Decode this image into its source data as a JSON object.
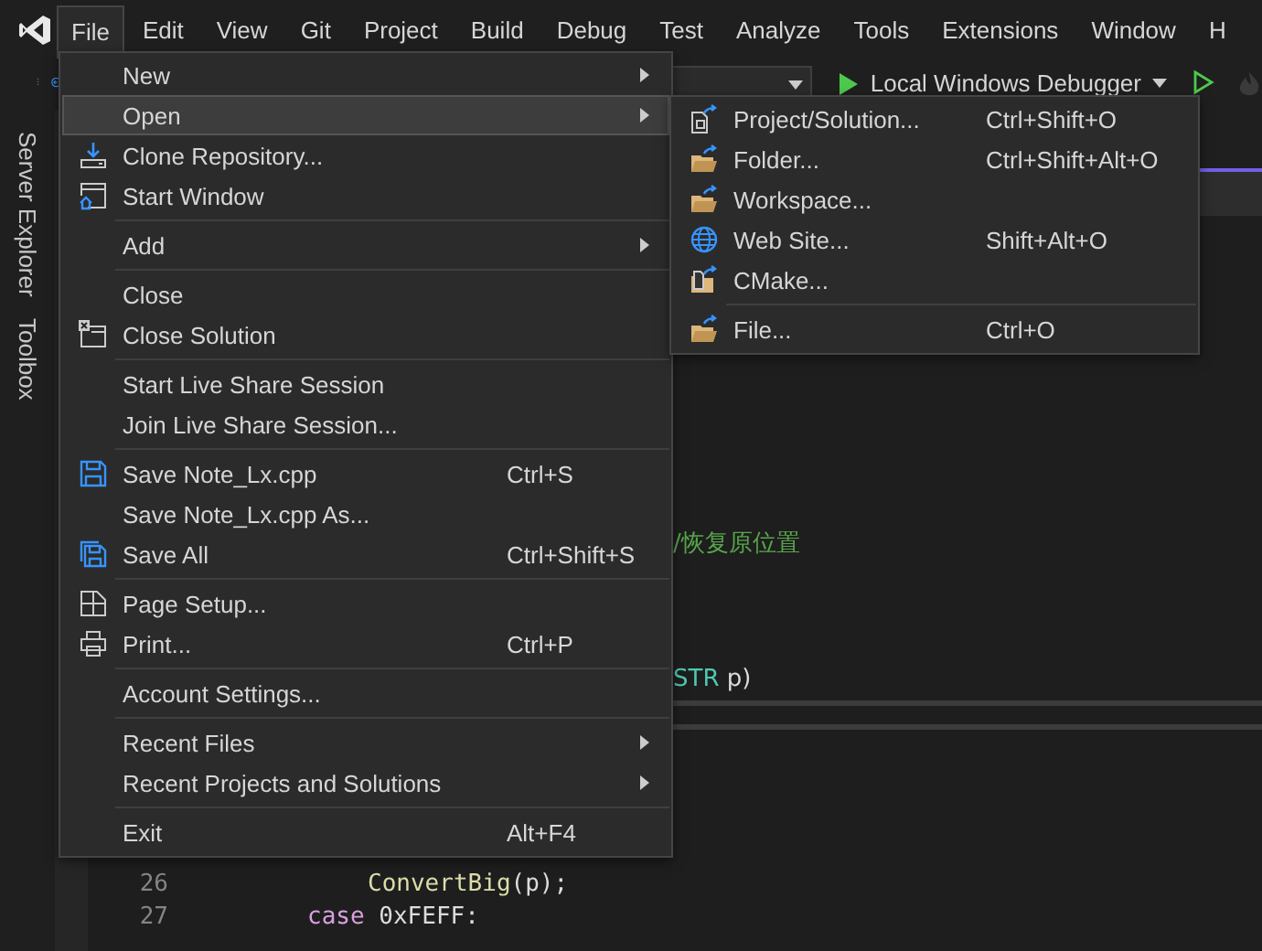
{
  "menu_bar": {
    "items": [
      {
        "label": "File",
        "selected": true
      },
      {
        "label": "Edit",
        "selected": false
      },
      {
        "label": "View",
        "selected": false
      },
      {
        "label": "Git",
        "selected": false
      },
      {
        "label": "Project",
        "selected": false
      },
      {
        "label": "Build",
        "selected": false
      },
      {
        "label": "Debug",
        "selected": false
      },
      {
        "label": "Test",
        "selected": false
      },
      {
        "label": "Analyze",
        "selected": false
      },
      {
        "label": "Tools",
        "selected": false
      },
      {
        "label": "Extensions",
        "selected": false
      },
      {
        "label": "Window",
        "selected": false
      },
      {
        "label": "H",
        "selected": false
      }
    ]
  },
  "toolbar": {
    "debugger": {
      "label": "Local Windows Debugger"
    }
  },
  "side_tabs": [
    {
      "label": "Server Explorer"
    },
    {
      "label": "Toolbox"
    }
  ],
  "editor": {
    "upper_lines": [
      {
        "segments": [
          {
            "kind": "comment",
            "text": "/恢复原位置"
          }
        ]
      },
      {
        "segments": [
          {
            "kind": "type",
            "text": "STR"
          },
          {
            "kind": "plain",
            "text": " p)"
          }
        ]
      }
    ],
    "lower_lines": [
      {
        "number": "26",
        "kind": "statement",
        "segments": [
          {
            "kind": "function",
            "text": "ConvertBig"
          },
          {
            "kind": "plain",
            "text": "(p);"
          }
        ]
      },
      {
        "number": "27",
        "kind": "label",
        "segments": [
          {
            "kind": "keyword",
            "text": "case"
          },
          {
            "kind": "plain",
            "text": " 0xFEFF:"
          }
        ]
      }
    ]
  },
  "file_menu": {
    "sections": [
      [
        {
          "label": "New",
          "has_submenu": true,
          "selected": false
        },
        {
          "label": "Open",
          "has_submenu": true,
          "selected": true
        },
        {
          "label": "Clone Repository...",
          "kind": "clone",
          "has_submenu": false,
          "selected": false
        },
        {
          "label": "Start Window",
          "kind": "start-window",
          "has_submenu": false,
          "selected": false
        }
      ],
      [
        {
          "label": "Add",
          "has_submenu": true,
          "selected": false
        }
      ],
      [
        {
          "label": "Close",
          "has_submenu": false,
          "selected": false
        },
        {
          "label": "Close Solution",
          "kind": "close-solution",
          "has_submenu": false,
          "selected": false
        }
      ],
      [
        {
          "label": "Start Live Share Session",
          "has_submenu": false,
          "selected": false
        },
        {
          "label": "Join Live Share Session...",
          "has_submenu": false,
          "selected": false
        }
      ],
      [
        {
          "label": "Save Note_Lx.cpp",
          "shortcut": "Ctrl+S",
          "kind": "save",
          "has_submenu": false,
          "selected": false
        },
        {
          "label": "Save Note_Lx.cpp As...",
          "has_submenu": false,
          "selected": false
        },
        {
          "label": "Save All",
          "shortcut": "Ctrl+Shift+S",
          "kind": "save-all",
          "has_submenu": false,
          "selected": false
        }
      ],
      [
        {
          "label": "Page Setup...",
          "kind": "page-setup",
          "has_submenu": false,
          "selected": false
        },
        {
          "label": "Print...",
          "shortcut": "Ctrl+P",
          "kind": "print",
          "has_submenu": false,
          "selected": false
        }
      ],
      [
        {
          "label": "Account Settings...",
          "has_submenu": false,
          "selected": false
        }
      ],
      [
        {
          "label": "Recent Files",
          "has_submenu": true,
          "selected": false
        },
        {
          "label": "Recent Projects and Solutions",
          "has_submenu": true,
          "selected": false
        }
      ],
      [
        {
          "label": "Exit",
          "shortcut": "Alt+F4",
          "has_submenu": false,
          "selected": false
        }
      ]
    ]
  },
  "open_submenu": {
    "sections": [
      [
        {
          "label": "Project/Solution...",
          "shortcut": "Ctrl+Shift+O",
          "kind": "project"
        },
        {
          "label": "Folder...",
          "shortcut": "Ctrl+Shift+Alt+O",
          "kind": "folder"
        },
        {
          "label": "Workspace...",
          "kind": "folder"
        },
        {
          "label": "Web Site...",
          "shortcut": "Shift+Alt+O",
          "kind": "globe"
        },
        {
          "label": "CMake...",
          "kind": "cmake"
        }
      ],
      [
        {
          "label": "File...",
          "shortcut": "Ctrl+O",
          "kind": "folder"
        }
      ]
    ]
  }
}
